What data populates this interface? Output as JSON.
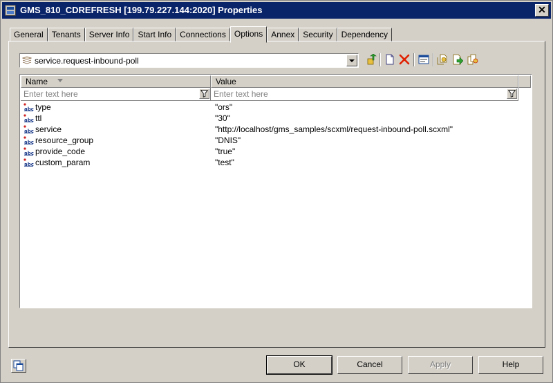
{
  "window": {
    "title": "GMS_810_CDREFRESH [199.79.227.144:2020] Properties",
    "close_label": "✕"
  },
  "tabs": [
    {
      "label": "General"
    },
    {
      "label": "Tenants"
    },
    {
      "label": "Server Info"
    },
    {
      "label": "Start Info"
    },
    {
      "label": "Connections"
    },
    {
      "label": "Options",
      "active": true
    },
    {
      "label": "Annex"
    },
    {
      "label": "Security"
    },
    {
      "label": "Dependency"
    }
  ],
  "section_selector": {
    "value": "service.request-inbound-poll",
    "icon": "section-icon"
  },
  "toolbar_icons": [
    "move-up-icon",
    "new-icon",
    "delete-icon",
    "edit-icon",
    "import-icon",
    "export-icon",
    "copy-icon"
  ],
  "grid": {
    "columns": [
      {
        "label": "Name"
      },
      {
        "label": "Value"
      }
    ],
    "filter_placeholder": "Enter text here",
    "rows": [
      {
        "name": "type",
        "value": "\"ors\""
      },
      {
        "name": "ttl",
        "value": "\"30\""
      },
      {
        "name": "service",
        "value": "\"http://localhost/gms_samples/scxml/request-inbound-poll.scxml\""
      },
      {
        "name": "resource_group",
        "value": "\"DNIS\""
      },
      {
        "name": "provide_code",
        "value": "\"true\""
      },
      {
        "name": "custom_param",
        "value": "\"test\""
      }
    ]
  },
  "buttons": {
    "ok": "OK",
    "cancel": "Cancel",
    "apply": "Apply",
    "help": "Help"
  },
  "colors": {
    "titlebar": "#0a246a",
    "face": "#d4d0c8",
    "delete_red": "#e02000"
  }
}
